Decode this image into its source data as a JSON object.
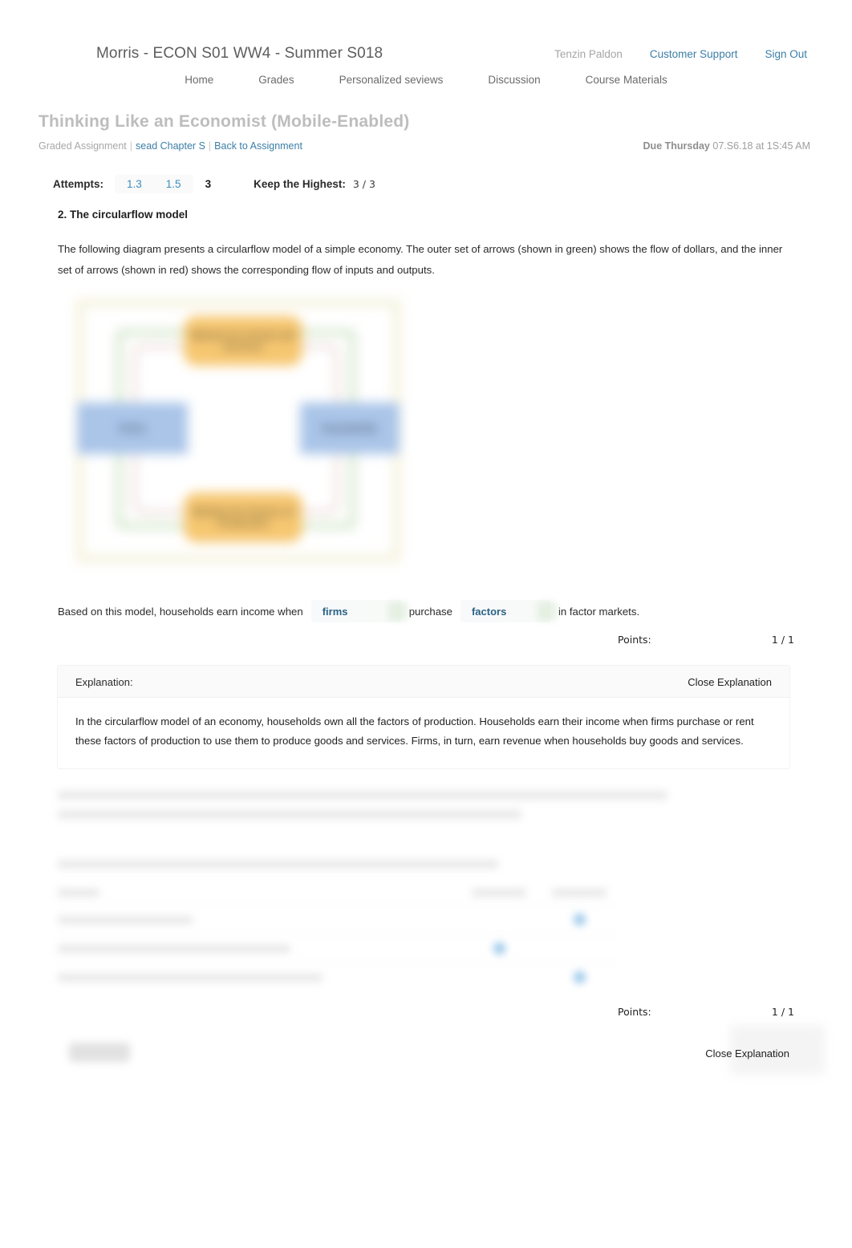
{
  "header": {
    "course_title": "Morris - ECON S01 WW4 - Summer S018",
    "user_name": "Tenzin Paldon",
    "customer_support": "Customer Support",
    "sign_out": "Sign Out",
    "nav": [
      {
        "label": "Home"
      },
      {
        "label": "Grades"
      },
      {
        "label": "Personalized seviews"
      },
      {
        "label": "Discussion"
      },
      {
        "label": "Course Materials"
      }
    ]
  },
  "assignment": {
    "title": "Thinking Like an Economist (Mobile-Enabled)",
    "type_label": "Graded Assignment",
    "chapter_link": "sead Chapter S",
    "back_link": "Back to Assignment",
    "due_prefix": "Due Thursday",
    "due_value": "07.S6.18 at 1S:45 AM"
  },
  "attempts": {
    "label": "Attempts:",
    "tabs": [
      {
        "label": "1.3",
        "current": false
      },
      {
        "label": "1.5",
        "current": false
      },
      {
        "label": "3",
        "current": true
      }
    ],
    "keep_label": "Keep the Highest:",
    "keep_value": "3 / 3"
  },
  "question": {
    "number_title": "2. The circularflow model",
    "prompt": "The following diagram presents a circularflow model of a simple economy. The outer set of arrows (shown in green) shows the flow of dollars, and the inner set of arrows (shown in red) shows the corresponding flow of inputs and outputs.",
    "diagram": {
      "top_box": "Markets for\nGoods and Services",
      "bottom_box": "Markets for\nFactors of Production",
      "left_box": "Firms",
      "right_box": "Households",
      "outer_flow_color": "#d9e9d2",
      "inner_flow_color": "#e4cfc9",
      "amber_color": "#f6c56c",
      "blue_color": "#a7c3e8"
    },
    "answer_sentence": {
      "part1": "Based on this model, households earn income when",
      "dropdown1": "firms",
      "part2": "purchase",
      "dropdown2": "factors",
      "part3": "in factor markets."
    },
    "points_label": "Points:",
    "points_value": "1 / 1",
    "explanation": {
      "header_label": "Explanation:",
      "close_label": "Close Explanation",
      "body": "In the circularflow model of an economy, households own all the factors of production. Households earn their income when firms purchase or rent these factors of production to use them to produce goods and services. Firms, in turn, earn revenue when households buy goods and services."
    }
  },
  "question2": {
    "points_label": "Points:",
    "points_value": "1 / 1",
    "close_label": "Close Explanation"
  },
  "colors": {
    "link": "#3c7ea6",
    "title_gray": "#bdbdbd",
    "text": "#2a2a2a",
    "dropdown_text": "#2b6285",
    "radio_blue": "#5aa5dd"
  }
}
